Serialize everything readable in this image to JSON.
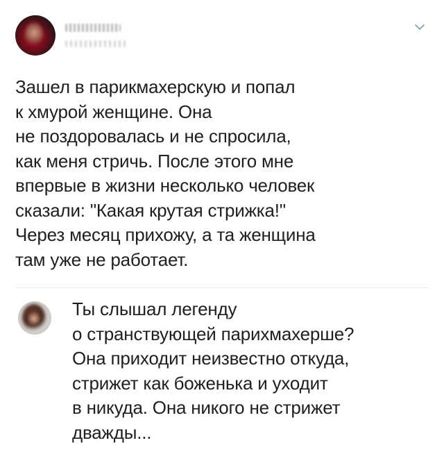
{
  "tweet": {
    "author_avatar": "avatar-photo-red",
    "menu_icon": "chevron-down-icon",
    "text_lines": [
      "Зашел в парикмахерскую и попал",
      "к хмурой женщине. Она",
      "не поздоровалась и не спросила,",
      "как меня стричь. После этого мне",
      "впервые в жизни несколько человек",
      "сказали: \"Какая крутая стрижка!\"",
      "Через месяц прихожу, а та женщина",
      "там уже не работает."
    ]
  },
  "reply": {
    "author_avatar": "avatar-photo-woman",
    "text_lines": [
      "Ты слышал легенду",
      "о странствующей парихмахерше?",
      "Она приходит неизвестно откуда,",
      "стрижет как боженька и уходит",
      "в никуда. Она никого не стрижет",
      "дважды..."
    ]
  },
  "colors": {
    "text": "#1f1f1f",
    "divider": "#e6ecf0",
    "chevron": "#8899a6",
    "background": "#ffffff"
  }
}
